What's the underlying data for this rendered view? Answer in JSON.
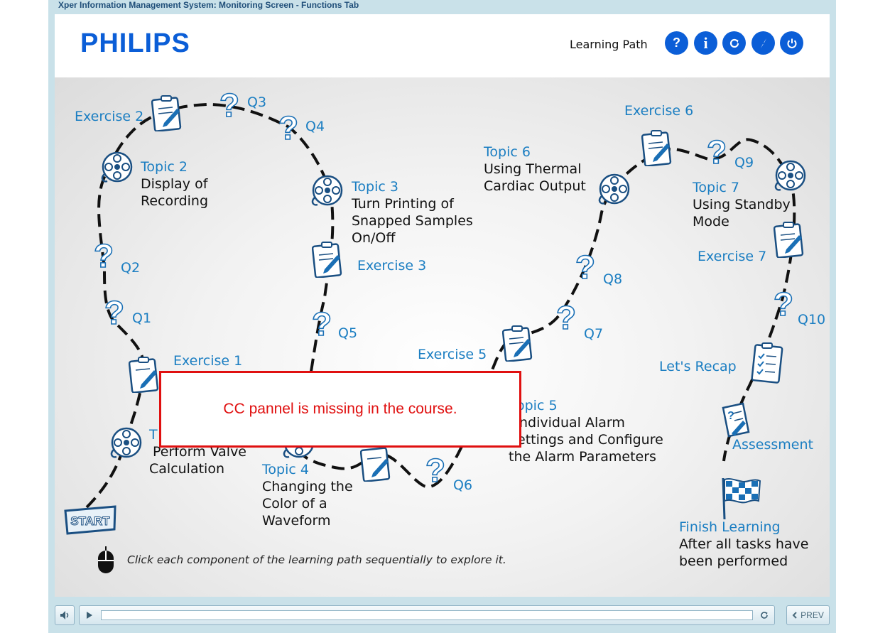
{
  "window": {
    "title": "Xper Information Management System: Monitoring Screen - Functions Tab"
  },
  "header": {
    "logo": "PHILIPS",
    "learning_path_label": "Learning Path",
    "buttons": [
      {
        "name": "help-button",
        "glyph": "?"
      },
      {
        "name": "info-button",
        "glyph": "i"
      },
      {
        "name": "refresh-button",
        "glyph": "refresh-icon"
      },
      {
        "name": "compass-button",
        "glyph": "compass-icon"
      },
      {
        "name": "power-button",
        "glyph": "power-icon"
      }
    ]
  },
  "path": {
    "start_label": "START",
    "exercises": {
      "e1": "Exercise 1",
      "e2": "Exercise 2",
      "e3": "Exercise 3",
      "e5": "Exercise 5",
      "e6": "Exercise 6",
      "e7": "Exercise 7"
    },
    "topics": {
      "t1": {
        "title": "T",
        "line1": "Perform Valve",
        "line2": "Calculation"
      },
      "t2": {
        "title": "Topic 2",
        "line1": "Display of",
        "line2": "Recording"
      },
      "t3": {
        "title": "Topic 3",
        "line1": "Turn Printing of",
        "line2": "Snapped Samples",
        "line3": "On/Off"
      },
      "t4": {
        "title": "Topic 4",
        "line1": "Changing the",
        "line2": "Color of a",
        "line3": "Waveform"
      },
      "t5": {
        "title": "opic 5",
        "line1": "ndividual Alarm",
        "line2": "ettings and Configure",
        "line3": "the Alarm Parameters"
      },
      "t6": {
        "title": "Topic 6",
        "line1": "Using Thermal",
        "line2": "Cardiac Output"
      },
      "t7": {
        "title": "Topic 7",
        "line1": "Using Standby",
        "line2": "Mode"
      }
    },
    "questions": {
      "q1": "Q1",
      "q2": "Q2",
      "q3": "Q3",
      "q4": "Q4",
      "q5": "Q5",
      "q6": "Q6",
      "q7": "Q7",
      "q8": "Q8",
      "q9": "Q9",
      "q10": "Q10"
    },
    "recap": "Let's Recap",
    "assessment": "Assessment",
    "finish": {
      "title": "Finish Learning",
      "line1": "After all tasks have",
      "line2": "been performed"
    },
    "question_glyph": "?"
  },
  "instruction": "Click each component of the learning path sequentially to explore it.",
  "cc_notice": "CC pannel is missing in the course.",
  "footer": {
    "prev_label": "PREV",
    "progress": 0
  },
  "colors": {
    "accent": "#0b5ed7",
    "label_blue": "#1b7ec2",
    "notice_red": "#e01010",
    "frame": "#c9e1e9"
  }
}
